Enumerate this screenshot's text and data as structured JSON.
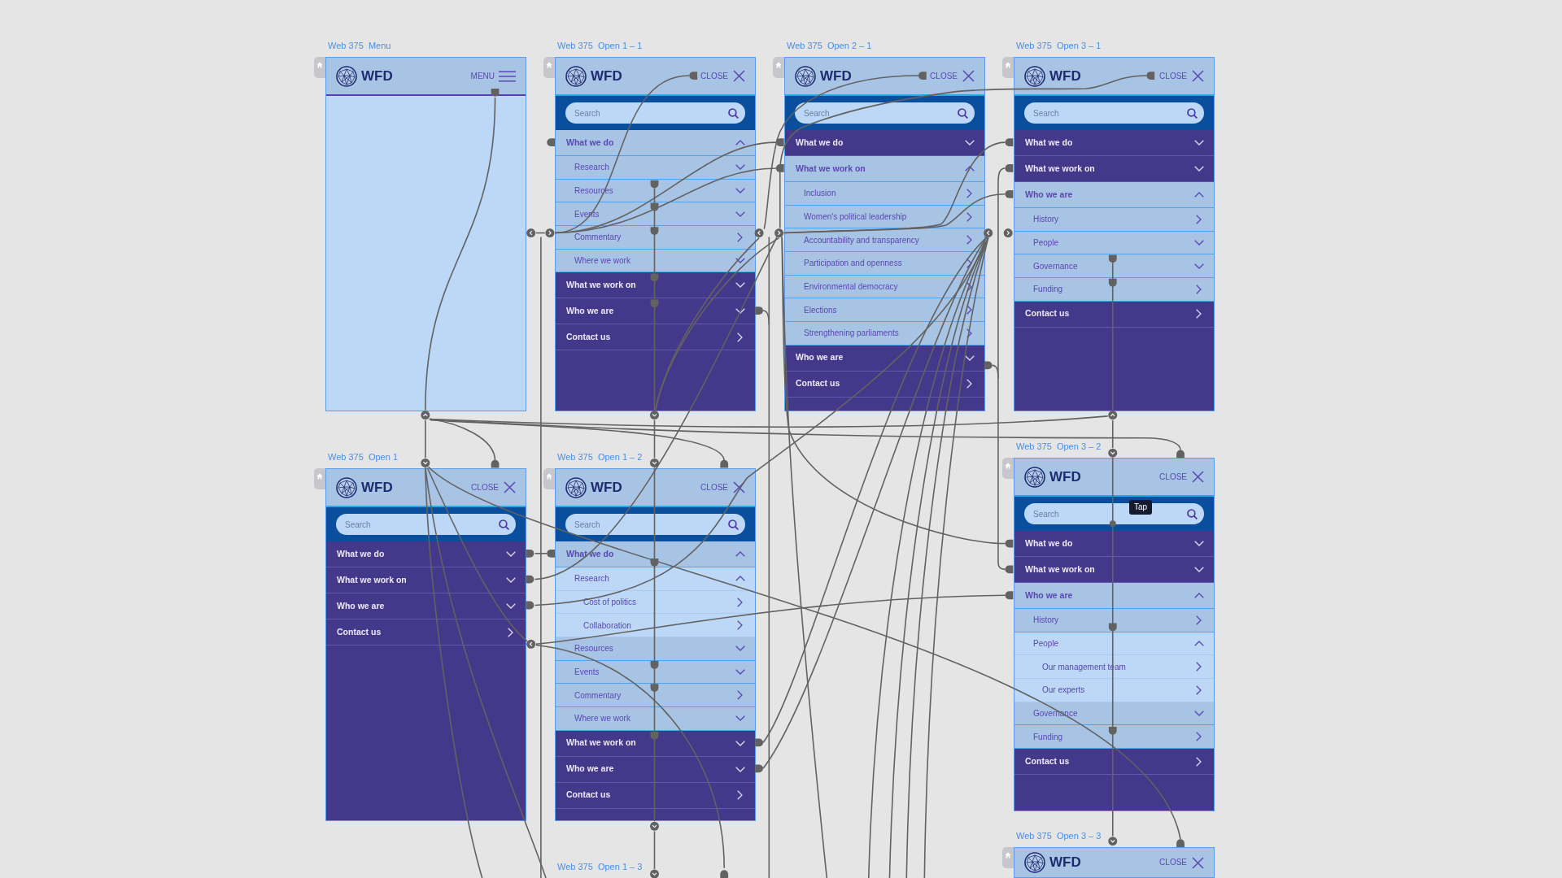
{
  "artboards": [
    {
      "title": "Web 375  Menu",
      "kind": "closed",
      "header": {
        "logo_text": "WFD",
        "action": {
          "kind": "menu",
          "label": "MENU"
        }
      }
    },
    {
      "title": "Web 375  Open 1 – 1",
      "kind": "open",
      "header": {
        "logo_text": "WFD",
        "action": {
          "kind": "close",
          "label": "CLOSE"
        }
      },
      "search": {
        "placeholder": "Search"
      },
      "menu": [
        {
          "label": "What we do",
          "kind": "group",
          "expanded": true,
          "children": [
            {
              "label": "Research",
              "kind": "group",
              "expanded": false
            },
            {
              "label": "Resources",
              "kind": "group",
              "expanded": false
            },
            {
              "label": "Events",
              "kind": "group",
              "expanded": false
            },
            {
              "label": "Commentary",
              "kind": "link"
            },
            {
              "label": "Where we work",
              "kind": "group",
              "expanded": false
            }
          ]
        },
        {
          "label": "What we work on",
          "kind": "group",
          "expanded": false
        },
        {
          "label": "Who we are",
          "kind": "group",
          "expanded": false
        },
        {
          "label": "Contact us",
          "kind": "link"
        }
      ]
    },
    {
      "title": "Web 375  Open 2 – 1",
      "kind": "open",
      "header": {
        "logo_text": "WFD",
        "action": {
          "kind": "close",
          "label": "CLOSE"
        }
      },
      "search": {
        "placeholder": "Search"
      },
      "menu": [
        {
          "label": "What we do",
          "kind": "group",
          "expanded": false
        },
        {
          "label": "What we work on",
          "kind": "group",
          "expanded": true,
          "children": [
            {
              "label": "Inclusion",
              "kind": "link"
            },
            {
              "label": "Women's political leadership",
              "kind": "link"
            },
            {
              "label": "Accountability and transparency",
              "kind": "link"
            },
            {
              "label": "Participation and openness",
              "kind": "link"
            },
            {
              "label": "Environmental democracy",
              "kind": "link"
            },
            {
              "label": "Elections",
              "kind": "link"
            },
            {
              "label": "Strengthening parliaments",
              "kind": "link"
            }
          ]
        },
        {
          "label": "Who we are",
          "kind": "group",
          "expanded": false
        },
        {
          "label": "Contact us",
          "kind": "link"
        }
      ]
    },
    {
      "title": "Web 375  Open 3 – 1",
      "kind": "open",
      "header": {
        "logo_text": "WFD",
        "action": {
          "kind": "close",
          "label": "CLOSE"
        }
      },
      "search": {
        "placeholder": "Search"
      },
      "menu": [
        {
          "label": "What we do",
          "kind": "group",
          "expanded": false
        },
        {
          "label": "What we work on",
          "kind": "group",
          "expanded": false
        },
        {
          "label": "Who we are",
          "kind": "group",
          "expanded": true,
          "children": [
            {
              "label": "History",
              "kind": "link"
            },
            {
              "label": "People",
              "kind": "group",
              "expanded": false
            },
            {
              "label": "Governance",
              "kind": "group",
              "expanded": false
            },
            {
              "label": "Funding",
              "kind": "link"
            }
          ]
        },
        {
          "label": "Contact us",
          "kind": "link"
        }
      ]
    },
    {
      "title": "Web 375  Open 1",
      "kind": "open",
      "header": {
        "logo_text": "WFD",
        "action": {
          "kind": "close",
          "label": "CLOSE"
        }
      },
      "search": {
        "placeholder": "Search"
      },
      "menu": [
        {
          "label": "What we do",
          "kind": "group",
          "expanded": false
        },
        {
          "label": "What we work on",
          "kind": "group",
          "expanded": false
        },
        {
          "label": "Who we are",
          "kind": "group",
          "expanded": false
        },
        {
          "label": "Contact us",
          "kind": "link"
        }
      ]
    },
    {
      "title": "Web 375  Open 1 – 2",
      "kind": "open",
      "header": {
        "logo_text": "WFD",
        "action": {
          "kind": "close",
          "label": "CLOSE"
        }
      },
      "search": {
        "placeholder": "Search"
      },
      "menu": [
        {
          "label": "What we do",
          "kind": "group",
          "expanded": true,
          "children": [
            {
              "label": "Research",
              "kind": "group",
              "expanded": true,
              "children": [
                {
                  "label": "Cost of politics",
                  "kind": "link"
                },
                {
                  "label": "Collaboration",
                  "kind": "link"
                }
              ]
            },
            {
              "label": "Resources",
              "kind": "group",
              "expanded": false
            },
            {
              "label": "Events",
              "kind": "group",
              "expanded": false
            },
            {
              "label": "Commentary",
              "kind": "link"
            },
            {
              "label": "Where we work",
              "kind": "group",
              "expanded": false
            }
          ]
        },
        {
          "label": "What we work on",
          "kind": "group",
          "expanded": false
        },
        {
          "label": "Who we are",
          "kind": "group",
          "expanded": false
        },
        {
          "label": "Contact us",
          "kind": "link"
        }
      ]
    },
    {
      "title": "Web 375  Open 3 – 2",
      "kind": "open",
      "header": {
        "logo_text": "WFD",
        "action": {
          "kind": "close",
          "label": "CLOSE"
        }
      },
      "search": {
        "placeholder": "Search"
      },
      "tooltip": {
        "text": "Tap"
      },
      "menu": [
        {
          "label": "What we do",
          "kind": "group",
          "expanded": false
        },
        {
          "label": "What we work on",
          "kind": "group",
          "expanded": false
        },
        {
          "label": "Who we are",
          "kind": "group",
          "expanded": true,
          "children": [
            {
              "label": "History",
              "kind": "link"
            },
            {
              "label": "People",
              "kind": "group",
              "expanded": true,
              "children": [
                {
                  "label": "Our management team",
                  "kind": "link"
                },
                {
                  "label": "Our experts",
                  "kind": "link"
                }
              ]
            },
            {
              "label": "Governance",
              "kind": "group",
              "expanded": false
            },
            {
              "label": "Funding",
              "kind": "link"
            }
          ]
        },
        {
          "label": "Contact us",
          "kind": "link"
        }
      ]
    },
    {
      "title": "Web 375  Open 3 – 3",
      "kind": "cropped",
      "header": {
        "logo_text": "WFD",
        "action": {
          "kind": "close",
          "label": "CLOSE"
        }
      }
    },
    {
      "title": "Web 375  Open 1 – 3",
      "kind": "offscreen"
    }
  ]
}
